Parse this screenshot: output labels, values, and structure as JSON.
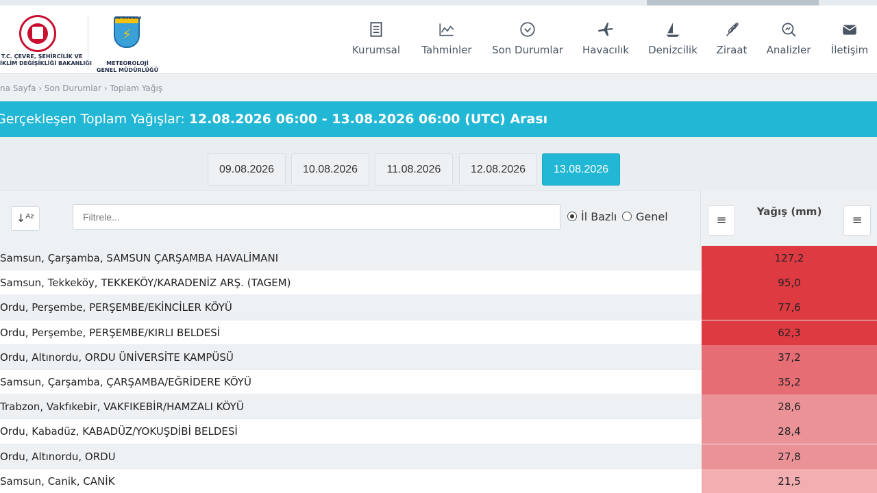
{
  "logos": {
    "ministry": "T.C. ÇEVRE, ŞEHİRCİLİK VE\nİKLİM DEĞİŞİKLİĞİ BAKANLIĞI",
    "ministry_line1": "T.C. ÇEVRE, ŞEHİRCİLİK VE",
    "ministry_line2": "İKLİM DEĞİŞİKLİĞİ BAKANLIĞI",
    "mgm_small": "METEOROLOJİ",
    "mgm_line1": "METEOROLOJİ",
    "mgm_line2": "GENEL MÜDÜRLÜĞÜ"
  },
  "nav": [
    {
      "label": "Kurumsal",
      "icon": "document-icon"
    },
    {
      "label": "Tahminler",
      "icon": "chart-icon"
    },
    {
      "label": "Son Durumlar",
      "icon": "check-circle-icon"
    },
    {
      "label": "Havacılık",
      "icon": "plane-icon"
    },
    {
      "label": "Denizcilik",
      "icon": "sail-icon"
    },
    {
      "label": "Ziraat",
      "icon": "wheat-icon"
    },
    {
      "label": "Analizler",
      "icon": "analysis-icon"
    },
    {
      "label": "İletişim",
      "icon": "mail-icon"
    }
  ],
  "breadcrumb": "na Sayfa › Son Durumlar › Toplam Yağış",
  "title": {
    "prefix": "Gerçekleşen Toplam Yağışlar: ",
    "range": "12.08.2026 06:00 - 13.08.2026 06:00 (UTC) Arası"
  },
  "dates": [
    "09.08.2026",
    "10.08.2026",
    "11.08.2026",
    "12.08.2026",
    "13.08.2026"
  ],
  "active_date": "13.08.2026",
  "filter": {
    "placeholder": "Filtrele...",
    "value": ""
  },
  "radios": [
    {
      "label": "İl Bazlı",
      "checked": true
    },
    {
      "label": "Genel",
      "checked": false
    }
  ],
  "yagis_header": "Yağış (mm)",
  "colors": {
    "accent": "#23b7d6",
    "very_high": "#de3a41",
    "high": "#e56d73",
    "mid": "#eb9297",
    "low": "#f2aeb1"
  },
  "rows": [
    {
      "name": "Samsun, Çarşamba, SAMSUN ÇARŞAMBA HAVALİMANI",
      "value": "127,2",
      "color": "#de3a41"
    },
    {
      "name": "Samsun, Tekkeköy, TEKKEKÖY/KARADENİZ ARŞ. (TAGEM)",
      "value": "95,0",
      "color": "#de3a41"
    },
    {
      "name": "Ordu, Perşembe, PERŞEMBE/EKİNCİLER KÖYÜ",
      "value": "77,6",
      "color": "#de3a41"
    },
    {
      "name": "Ordu, Perşembe, PERŞEMBE/KIRLI BELDESİ",
      "value": "62,3",
      "color": "#de3a41"
    },
    {
      "name": "Ordu, Altınordu, ORDU ÜNİVERSİTE KAMPÜSÜ",
      "value": "37,2",
      "color": "#e56d73"
    },
    {
      "name": "Samsun, Çarşamba, ÇARŞAMBA/EĞRİDERE KÖYÜ",
      "value": "35,2",
      "color": "#e56d73"
    },
    {
      "name": "Trabzon, Vakfıkebir, VAKFIKEBİR/HAMZALI KÖYÜ",
      "value": "28,6",
      "color": "#eb9297"
    },
    {
      "name": "Ordu, Kabadüz, KABADÜZ/YOKUŞDİBİ BELDESİ",
      "value": "28,4",
      "color": "#eb9297"
    },
    {
      "name": "Ordu, Altınordu, ORDU",
      "value": "27,8",
      "color": "#eb9297"
    },
    {
      "name": "Samsun, Canik, CANİK",
      "value": "21,5",
      "color": "#f2aeb1"
    }
  ]
}
